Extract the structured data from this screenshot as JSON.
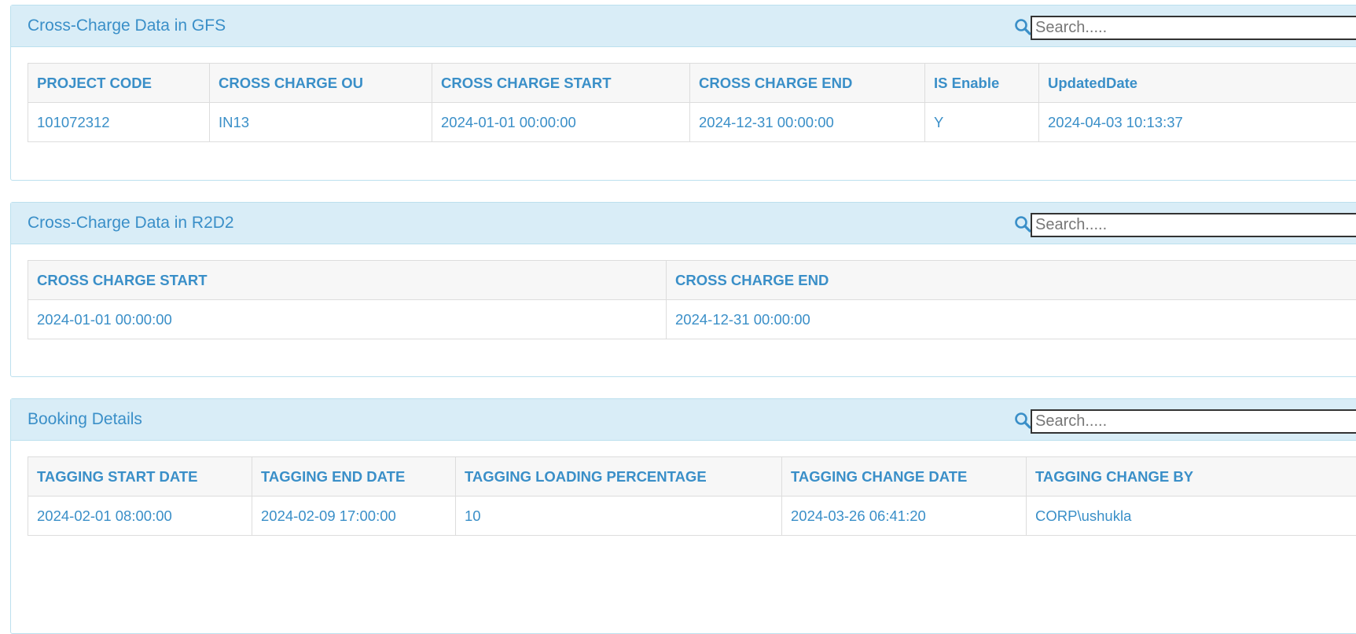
{
  "panels": {
    "gfs": {
      "title": "Cross-Charge Data in GFS",
      "search_placeholder": "Search.....",
      "columns": [
        "PROJECT CODE",
        "CROSS CHARGE OU",
        "CROSS CHARGE START",
        "CROSS CHARGE END",
        "IS Enable",
        "UpdatedDate"
      ],
      "rows": [
        [
          "101072312",
          "IN13",
          "2024-01-01 00:00:00",
          "2024-12-31 00:00:00",
          "Y",
          "2024-04-03 10:13:37"
        ]
      ]
    },
    "r2d2": {
      "title": "Cross-Charge Data in R2D2",
      "search_placeholder": "Search.....",
      "columns": [
        "CROSS CHARGE START",
        "CROSS CHARGE END"
      ],
      "rows": [
        [
          "2024-01-01 00:00:00",
          "2024-12-31 00:00:00"
        ]
      ]
    },
    "booking": {
      "title": "Booking Details",
      "search_placeholder": "Search.....",
      "columns": [
        "TAGGING START DATE",
        "TAGGING END DATE",
        "TAGGING LOADING PERCENTAGE",
        "TAGGING CHANGE DATE",
        "TAGGING CHANGE BY"
      ],
      "rows": [
        [
          "2024-02-01 08:00:00",
          "2024-02-09 17:00:00",
          "10",
          "2024-03-26 06:41:20",
          "CORP\\ushukla"
        ]
      ]
    }
  },
  "colors": {
    "heading_bg": "#d9edf7",
    "accent_text": "#3a8fc8",
    "border": "#bce0ee"
  },
  "icons": {
    "search": "search-icon"
  }
}
